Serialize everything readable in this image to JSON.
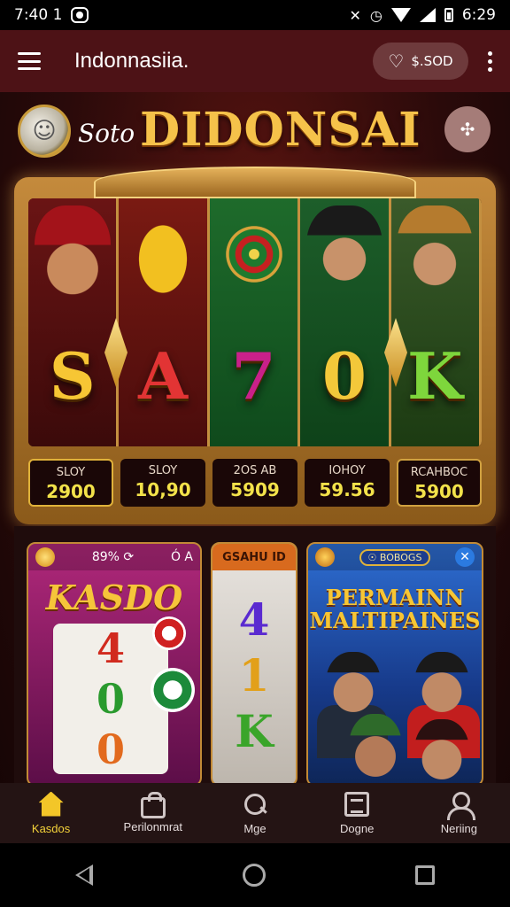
{
  "status_bar": {
    "time_left": "7:40 1",
    "time_right": "6:29",
    "icons": [
      "notification-icon",
      "mute-icon",
      "alarm-icon",
      "wifi-icon",
      "signal-icon",
      "battery-icon"
    ]
  },
  "app_bar": {
    "title": "Indonnasiia.",
    "balance": "$.SOD",
    "balance_icon": "heart-icon"
  },
  "banner": {
    "prefix": "Soto",
    "brand": "DIDONSAI"
  },
  "slot": {
    "symbols": [
      "S",
      "A",
      "7",
      "0",
      "K"
    ],
    "stats": [
      {
        "label": "SLOY",
        "value": "2900"
      },
      {
        "label": "SLOY",
        "value": "10,90"
      },
      {
        "label": "2OS AB",
        "value": "5909"
      },
      {
        "label": "IOHOY",
        "value": "59.56"
      },
      {
        "label": "RCAHBOC",
        "value": "5900"
      }
    ]
  },
  "cards": {
    "card1": {
      "badge": "89% ⟳",
      "mini": "Ó A",
      "title": "KASDO",
      "reels": [
        "4",
        "0",
        "0"
      ]
    },
    "card2": {
      "header": "GSAHU ID",
      "reels": [
        "4",
        "1",
        "K"
      ]
    },
    "card3": {
      "pill": "☉ BOBOGS",
      "close": "✕",
      "title_line1": "PERMAINN",
      "title_line2": "MALTIPAINES"
    }
  },
  "bottom_nav": [
    {
      "label": "Kasdos",
      "icon": "home-icon",
      "active": true
    },
    {
      "label": "Perilonmrat",
      "icon": "bag-icon",
      "active": false
    },
    {
      "label": "Mge",
      "icon": "search-icon",
      "active": false
    },
    {
      "label": "Dogne",
      "icon": "document-icon",
      "active": false
    },
    {
      "label": "Neriing",
      "icon": "user-icon",
      "active": false
    }
  ],
  "colors": {
    "accent": "#f3c628",
    "app_bar": "#4d1216",
    "gold": "#f5c24a"
  }
}
